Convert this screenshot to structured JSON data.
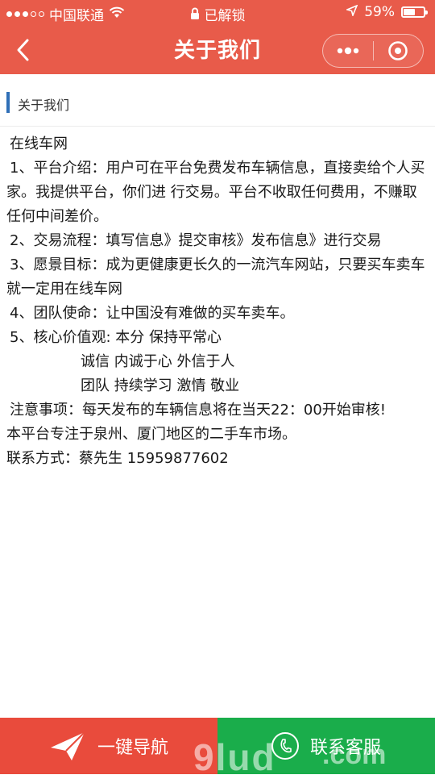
{
  "status_bar": {
    "carrier": "中国联通",
    "lock_text": "已解锁",
    "battery": "59%",
    "battery_level": 0.59
  },
  "nav": {
    "title": "关于我们"
  },
  "section": {
    "title": "关于我们"
  },
  "content": {
    "lines": [
      "在线车网",
      "1、平台介绍：用户可在平台免费发布车辆信息，直接卖给个人买家。我提供平台，你们进  行交易。平台不收取任何费用，不赚取任何中间差价。",
      "2、交易流程：填写信息》提交审核》发布信息》进行交易",
      "3、愿景目标：成为更健康更长久的一流汽车网站，只要买车卖车就一定用在线车网",
      "4、团队使命：让中国没有难做的买车卖车。",
      "5、核心价值观: 本分 保持平常心",
      "诚信 内诚于心 外信于人",
      "团队 持续学习 激情 敬业",
      "注意事项：每天发布的车辆信息将在当天22：00开始审核!",
      "本平台专注于泉州、厦门地区的二手车市场。",
      "联系方式：蔡先生  15959877602"
    ]
  },
  "bottom_bar": {
    "nav_label": "一键导航",
    "service_label": "联系客服",
    "nav_color": "#e94b3c",
    "service_color": "#1aad4b"
  },
  "watermark": {
    "text": "9lud",
    "domain": ".com"
  },
  "colors": {
    "header": "#e85b4a",
    "accent_bar": "#2f6fb7"
  },
  "icons": {
    "wifi": "wifi-icon",
    "lock": "lock-icon",
    "location": "location-arrow-icon",
    "back": "back-chevron-icon",
    "more": "more-dots-icon",
    "close": "target-close-icon",
    "paper_plane": "paper-plane-icon",
    "phone": "phone-icon"
  }
}
